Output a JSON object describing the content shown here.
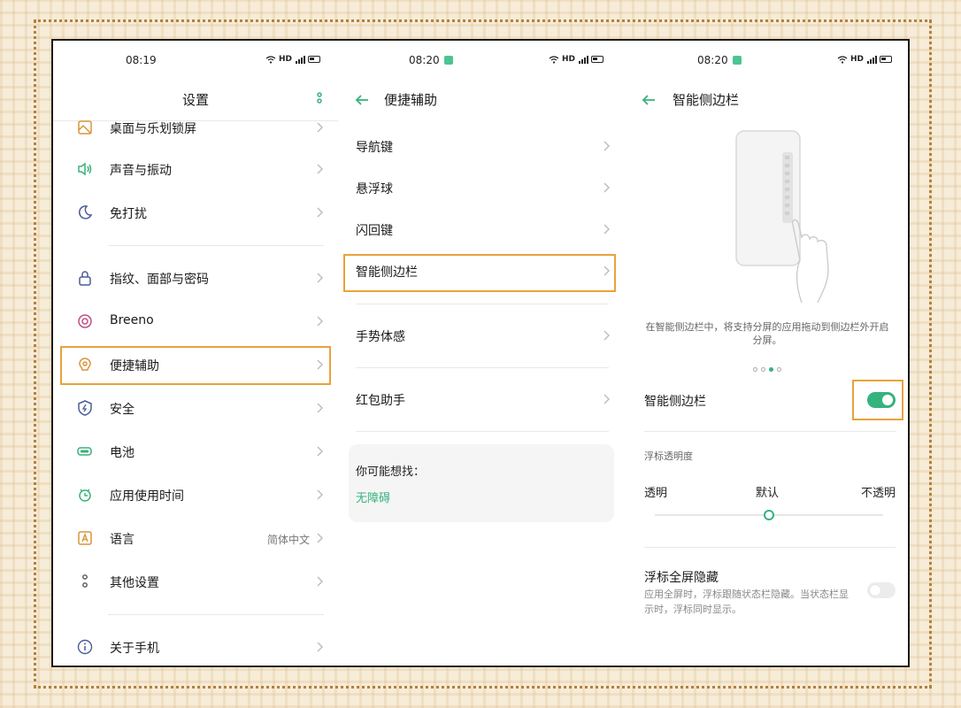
{
  "colors": {
    "accent": "#35b37e",
    "highlight": "#e9a23b",
    "icon": "#5a6fa8"
  },
  "panel1": {
    "status_time": "08:19",
    "status_net": "HD",
    "title": "设置",
    "items": [
      {
        "label": "桌面与乐划锁屏",
        "icon": "wallpaper-icon"
      },
      {
        "label": "声音与振动",
        "icon": "speaker-icon"
      },
      {
        "label": "免打扰",
        "icon": "moon-icon"
      },
      {
        "label": "指纹、面部与密码",
        "icon": "lock-icon"
      },
      {
        "label": "Breeno",
        "icon": "breeno-icon"
      },
      {
        "label": "便捷辅助",
        "icon": "assist-icon"
      },
      {
        "label": "安全",
        "icon": "shield-icon"
      },
      {
        "label": "电池",
        "icon": "battery-icon"
      },
      {
        "label": "应用使用时间",
        "icon": "app-time-icon"
      },
      {
        "label": "语言",
        "icon": "language-icon",
        "value": "简体中文"
      },
      {
        "label": "其他设置",
        "icon": "more-settings-icon"
      },
      {
        "label": "关于手机",
        "icon": "info-icon"
      }
    ]
  },
  "panel2": {
    "status_time": "08:20",
    "status_net": "HD",
    "title": "便捷辅助",
    "items": [
      {
        "label": "导航键"
      },
      {
        "label": "悬浮球"
      },
      {
        "label": "闪回键"
      },
      {
        "label": "智能侧边栏"
      },
      {
        "label": "手势体感"
      },
      {
        "label": "红包助手"
      }
    ],
    "suggest_title": "你可能想找：",
    "suggest_link": "无障碍"
  },
  "panel3": {
    "status_time": "08:20",
    "status_net": "HD",
    "title": "智能侧边栏",
    "desc": "在智能侧边栏中，将支持分屏的应用拖动到侧边栏外开启分屏。",
    "page_dots": 4,
    "page_active": 3,
    "toggle_label": "智能侧边栏",
    "toggle_on": true,
    "opacity_title": "浮标透明度",
    "opacity_low": "透明",
    "opacity_mid": "默认",
    "opacity_high": "不透明",
    "opacity_level": 0.5,
    "hide_title": "浮标全屏隐藏",
    "hide_desc": "应用全屏时，浮标跟随状态栏隐藏。当状态栏显示时，浮标同时显示。",
    "hide_on": false
  }
}
